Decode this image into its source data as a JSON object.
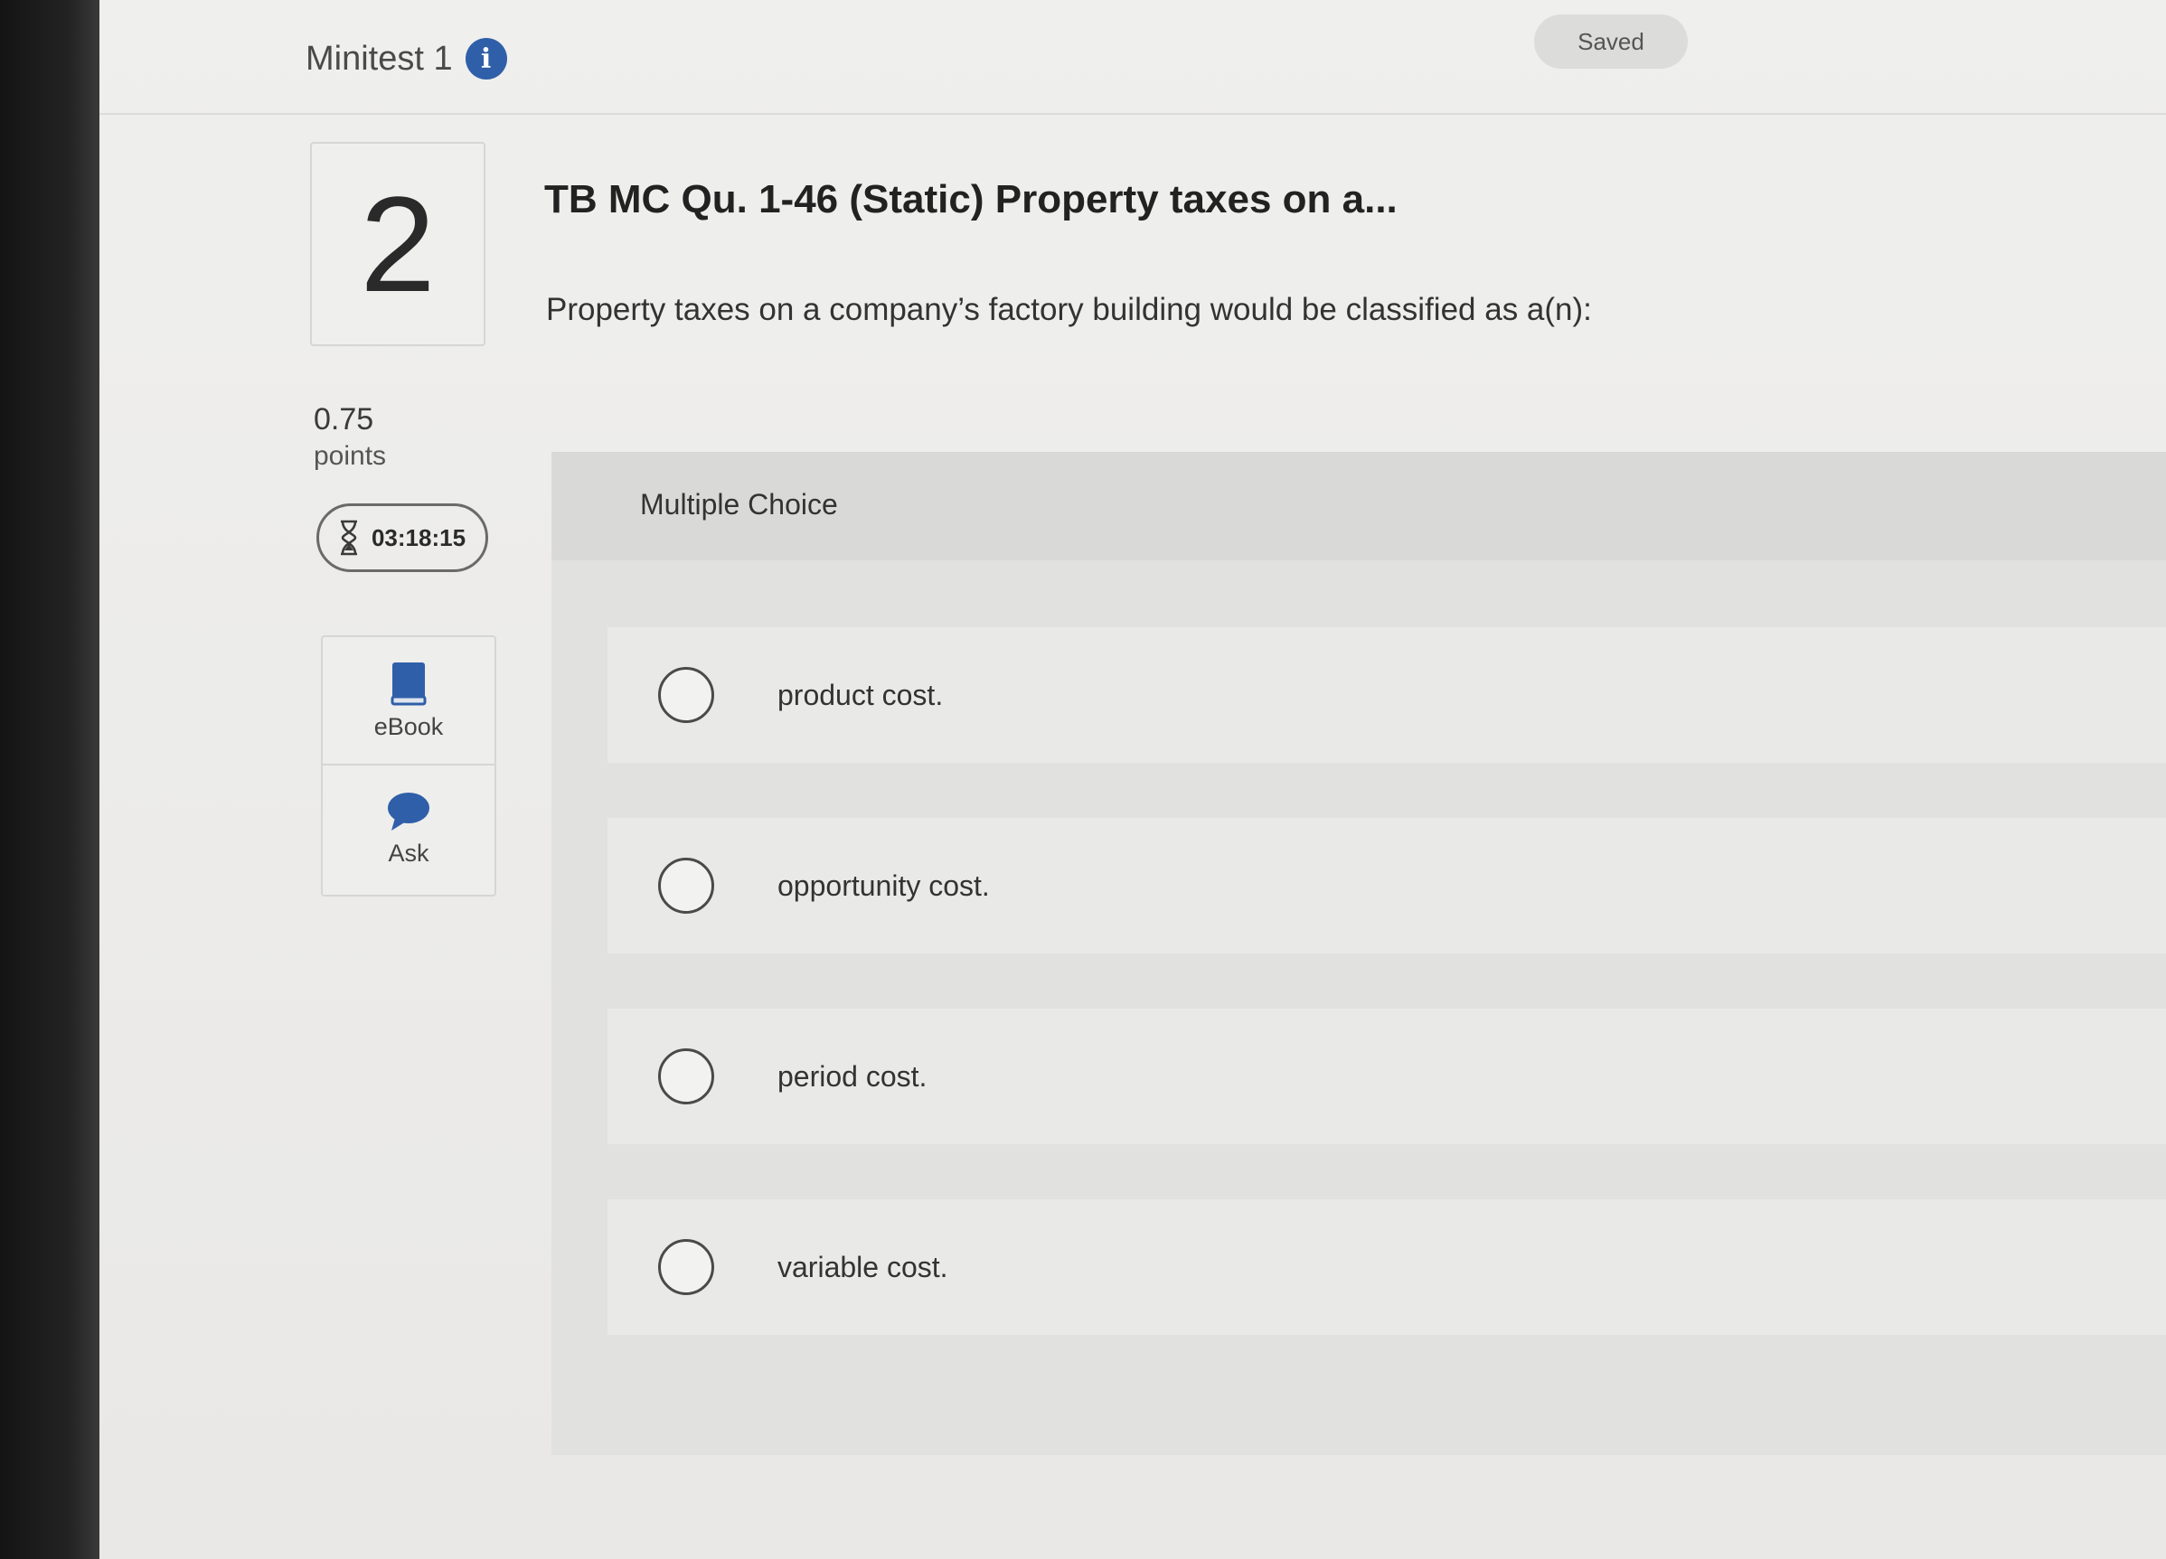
{
  "header": {
    "title": "Minitest 1",
    "info_icon": "info-icon",
    "status": "Saved"
  },
  "question": {
    "number": "2",
    "points_value": "0.75",
    "points_label": "points",
    "timer": "03:18:15",
    "heading": "TB MC Qu. 1-46 (Static) Property taxes on a...",
    "text": "Property taxes on a company’s factory building would be classified as a(n):"
  },
  "tools": [
    {
      "label": "eBook",
      "icon": "book-icon"
    },
    {
      "label": "Ask",
      "icon": "speech-bubble-icon"
    }
  ],
  "answer": {
    "type_label": "Multiple Choice",
    "options": [
      {
        "label": "product cost."
      },
      {
        "label": "opportunity cost."
      },
      {
        "label": "period cost."
      },
      {
        "label": "variable cost."
      }
    ]
  },
  "colors": {
    "accent": "#2f5fa8",
    "page_bg": "#ecebea",
    "panel_bg": "#e1e1e0"
  }
}
